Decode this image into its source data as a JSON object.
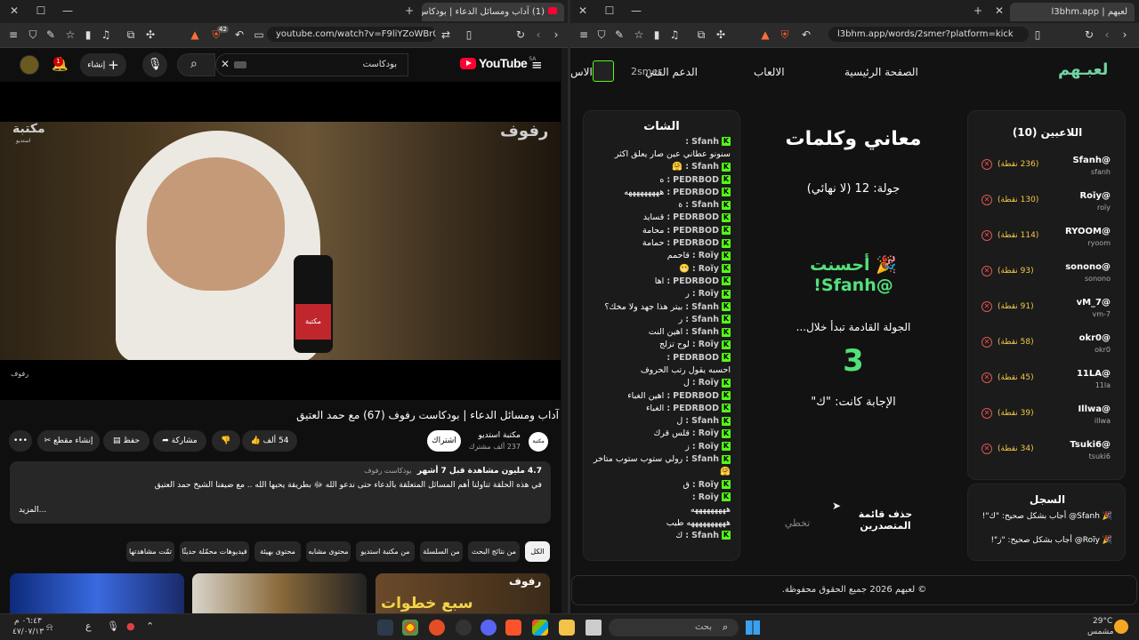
{
  "left_browser": {
    "tab_title": "(1) آداب ومسائل الدعاء | بودكاس...",
    "url": "youtube.com/watch?v=F9liYZoWBr0&t=4s",
    "badge_count": "42"
  },
  "youtube": {
    "logo_text": "YouTube",
    "logo_region": "SA",
    "search_value": "بودكاست",
    "create_label": "إنشاء",
    "notif_count": "1",
    "video_watermark_right": "رفوف",
    "video_watermark_left": "مكتبة",
    "video_watermark_left_sub": "استديو",
    "mic_label": "مكتبة",
    "player_channel_tag": "رفوف",
    "video_title": "آداب ومسائل الدعاء | بودكاست رفوف (67) مع حمد العتيق",
    "channel_name": "مكتبة استديو",
    "subscribers": "237 ألف مشترك",
    "subscribe_label": "اشتراك",
    "likes": "54 ألف",
    "share_label": "مشاركة",
    "save_label": "حفظ",
    "clip_label": "إنشاء مقطع",
    "desc_views": "4.7 مليون مشاهدة قبل 7 أشهر",
    "desc_tag": "بودكاست رفوف",
    "desc_text": "في هذه الحلقة تناولنا أهم المسائل المتعلقة بالدعاء حتى ندعو الله ﷻ بطريقة يحبها الله .. مع ضيفنا الشيخ حمد العتيق",
    "desc_more": "...المزيد",
    "chips": [
      "الكل",
      "من نتائج البحث",
      "من السلسلة",
      "من مكتبة استديو",
      "محتوى مشابه",
      "محتوى بهيئة",
      "فيديوهات محمّلة حديثًا",
      "تمّت مشاهدتها"
    ],
    "thumb_texts": [
      "رفوف",
      "سبع خطوات"
    ]
  },
  "right_browser": {
    "tab_title": "لعبهم | l3bhm.app",
    "url": "l3bhm.app/words/2smer?platform=kick"
  },
  "app": {
    "logo": "لعبـهم",
    "nav": [
      "الصفحة الرئيسية",
      "الالعاب",
      "الدعم الفني",
      "الاس"
    ],
    "username": "2smer",
    "game_title": "معاني وكلمات",
    "round_label": "جولة: 12 (لا نهائي)",
    "winner_line1": "🎉 أحسنت",
    "winner_line2": "!Sfanh@",
    "next_round_label": "الجولة القادمة تبدأ خلال...",
    "countdown": "3",
    "answer_label": "الإجابة كانت: \"ك\"",
    "skip_label": "تخطي",
    "clear_leaderboard_label": "حذف قائمة المتصدرين",
    "chat_title": "الشات",
    "chat": [
      {
        "user": "Sfanh",
        "msg": ""
      },
      {
        "user": "",
        "msg": "سنونو عطاني عين صار يعلق اكثر"
      },
      {
        "user": "Sfanh",
        "msg": "🤗"
      },
      {
        "user": "PEDRBOD",
        "msg": "ه"
      },
      {
        "user": "PEDRBOD",
        "msg": "هههههههههه"
      },
      {
        "user": "Sfanh",
        "msg": "ة"
      },
      {
        "user": "PEDRBOD",
        "msg": "قسايد"
      },
      {
        "user": "PEDRBOD",
        "msg": "محامة"
      },
      {
        "user": "PEDRBOD",
        "msg": "حمامة"
      },
      {
        "user": "Roĭy",
        "msg": "قاحمم"
      },
      {
        "user": "Roĭy",
        "msg": "😬"
      },
      {
        "user": "PEDRBOD",
        "msg": "اها"
      },
      {
        "user": "Roĭy",
        "msg": "ر"
      },
      {
        "user": "Sfanh",
        "msg": "بيتر هذا جهد ولا مخك؟"
      },
      {
        "user": "Sfanh",
        "msg": "ر"
      },
      {
        "user": "Sfanh",
        "msg": "اهين النت"
      },
      {
        "user": "Roĭy",
        "msg": "لوح تزلج"
      },
      {
        "user": "PEDRBOD",
        "msg": ""
      },
      {
        "user": "",
        "msg": "احسبه يقول رتب الحروف"
      },
      {
        "user": "Roĭy",
        "msg": "ل"
      },
      {
        "user": "PEDRBOD",
        "msg": "اهين الغباء"
      },
      {
        "user": "PEDRBOD",
        "msg": "الغباء"
      },
      {
        "user": "Sfanh",
        "msg": "ل"
      },
      {
        "user": "Roĭy",
        "msg": "قلس قرك"
      },
      {
        "user": "Roĭy",
        "msg": "ز"
      },
      {
        "user": "Sfanh",
        "msg": "رولي ستوب ستوب متاخر"
      },
      {
        "user": "",
        "msg": "🤗"
      },
      {
        "user": "Roĭy",
        "msg": "ق"
      },
      {
        "user": "Roĭy",
        "msg": ""
      },
      {
        "user": "",
        "msg": "هههههههههه"
      },
      {
        "user": "",
        "msg": "ههههههههههه طيب"
      },
      {
        "user": "Sfanh",
        "msg": "ك"
      }
    ],
    "players_title": "اللاعبين (10)",
    "players": [
      {
        "handle": "@Sfanh",
        "sub": "sfanh",
        "points": "(236 نقطة)"
      },
      {
        "handle": "@Roĭy",
        "sub": "roĭy",
        "points": "(130 نقطة)"
      },
      {
        "handle": "@RYOOM",
        "sub": "ryoom",
        "points": "(114 نقطة)"
      },
      {
        "handle": "@sonono",
        "sub": "sonono",
        "points": "(93 نقطة)"
      },
      {
        "handle": "@vM_7",
        "sub": "vm-7",
        "points": "(91 نقطة)"
      },
      {
        "handle": "@okr0",
        "sub": "okr0",
        "points": "(58 نقطة)"
      },
      {
        "handle": "@11LA",
        "sub": "11la",
        "points": "(45 نقطة)"
      },
      {
        "handle": "@Illwa",
        "sub": "illwa",
        "points": "(39 نقطة)"
      },
      {
        "handle": "@Tsuki6",
        "sub": "tsuki6",
        "points": "(34 نقطة)"
      }
    ],
    "log_title": "السجل",
    "log": [
      "🎉 Sfanh@ أجاب بشكل صحيح: \"ك\"!",
      "🎉 Roĭy@ أجاب بشكل صحيح: \"ز\"!"
    ],
    "footer": "© لعبهم 2026 جميع الحقوق محفوظة."
  },
  "taskbar": {
    "time": "٠٦:٤٣ م",
    "date": "٤٧/٠٧/١٣",
    "lang": "ع",
    "search_placeholder": "بحث",
    "weather_temp": "29°C",
    "weather_desc": "مشمس"
  },
  "colors": {
    "youtube_red": "#ff0033",
    "kick_green": "#53fc18",
    "winner_green": "#53e07a",
    "points_yellow": "#f3c846",
    "remove_red": "#e05555"
  }
}
